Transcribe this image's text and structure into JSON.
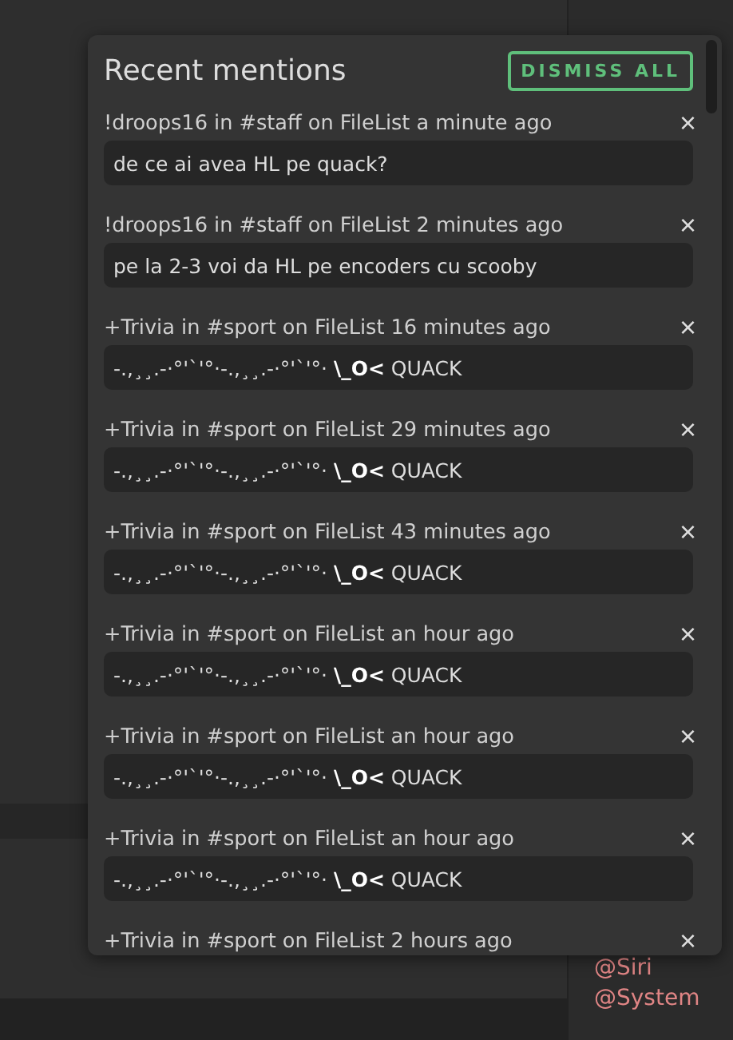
{
  "popover": {
    "title": "Recent mentions",
    "dismiss_all": "DISMISS ALL",
    "close_glyph": "×",
    "mentions": [
      {
        "header": "!droops16 in #staff on FileList a minute ago",
        "message": "de ce ai avea HL pe quack?"
      },
      {
        "header": "!droops16 in #staff on FileList 2 minutes ago",
        "message": "pe la 2-3 voi da HL pe encoders cu scooby"
      },
      {
        "header": "+Trivia in #sport on FileList 16 minutes ago",
        "message": "-.,¸¸.-·°'`'°·-.,¸¸.-·°'`'°· **\\_O<** QUACK"
      },
      {
        "header": "+Trivia in #sport on FileList 29 minutes ago",
        "message": "-.,¸¸.-·°'`'°·-.,¸¸.-·°'`'°· **\\_O<** QUACK"
      },
      {
        "header": "+Trivia in #sport on FileList 43 minutes ago",
        "message": "-.,¸¸.-·°'`'°·-.,¸¸.-·°'`'°· **\\_O<** QUACK"
      },
      {
        "header": "+Trivia in #sport on FileList an hour ago",
        "message": "-.,¸¸.-·°'`'°·-.,¸¸.-·°'`'°· **\\_O<** QUACK"
      },
      {
        "header": "+Trivia in #sport on FileList an hour ago",
        "message": "-.,¸¸.-·°'`'°·-.,¸¸.-·°'`'°· **\\_O<** QUACK"
      },
      {
        "header": "+Trivia in #sport on FileList an hour ago",
        "message": "-.,¸¸.-·°'`'°·-.,¸¸.-·°'`'°· **\\_O<** QUACK"
      },
      {
        "header": "+Trivia in #sport on FileList 2 hours ago"
      }
    ]
  },
  "user_list": [
    "@Siri",
    "@System"
  ]
}
